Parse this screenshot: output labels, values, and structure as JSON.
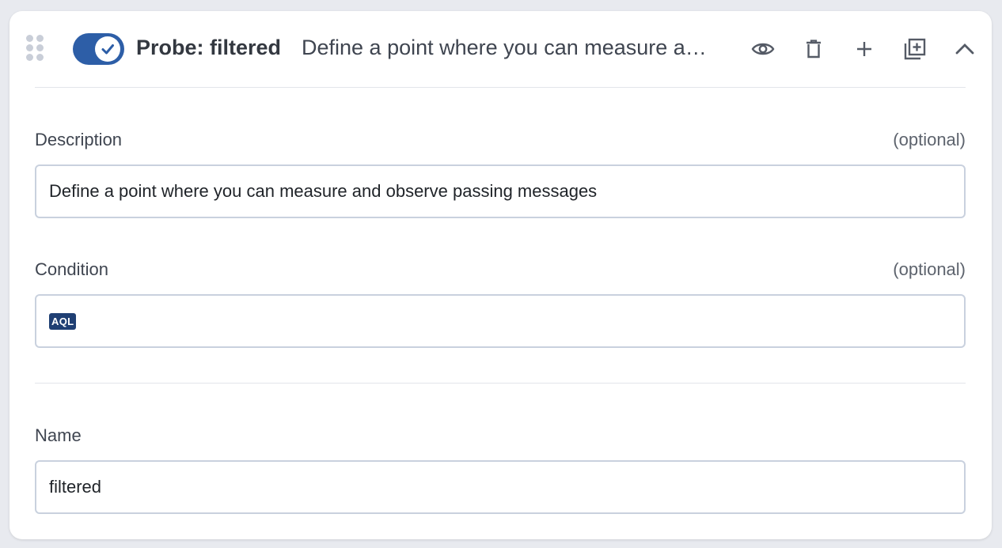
{
  "header": {
    "title": "Probe: filtered",
    "description_preview": "Define a point where you can measure a…",
    "toggle_enabled": true,
    "actions": [
      "eye-icon",
      "trash-icon",
      "plus-icon",
      "duplicate-icon",
      "chevron-up-icon"
    ]
  },
  "fields": {
    "description": {
      "label": "Description",
      "optional": "(optional)",
      "value": "Define a point where you can measure and observe passing messages"
    },
    "condition": {
      "label": "Condition",
      "optional": "(optional)",
      "badge": "AQL",
      "value": ""
    },
    "name": {
      "label": "Name",
      "value": "filtered"
    }
  },
  "colors": {
    "toggle": "#2d5ea7",
    "badge": "#1f3f73",
    "input_border": "#c9d1de"
  }
}
